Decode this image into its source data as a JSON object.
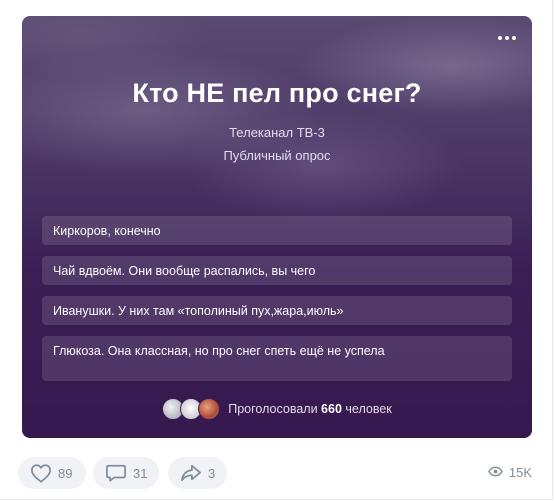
{
  "poll": {
    "title": "Кто НЕ пел про снег?",
    "author": "Телеканал ТВ-3",
    "type": "Публичный опрос",
    "answers": [
      {
        "label": "Киркоров, конечно"
      },
      {
        "label": "Чай вдвоём. Они вообще распались, вы чего"
      },
      {
        "label": "Иванушки. У них там «тополиный пух,жара,июль»"
      },
      {
        "label": "Глюкоза. Она классная, но про снег спеть ещё не успела"
      }
    ],
    "voters": {
      "prefix": "Проголосовали",
      "count": "660",
      "suffix": "человек"
    }
  },
  "actions": {
    "likes": "89",
    "comments": "31",
    "shares": "3",
    "views": "15K"
  },
  "colors": {
    "card_top": "#5a4a72",
    "card_bottom": "#35184e",
    "action_bg": "#f0f2f5",
    "action_text": "#818c99"
  },
  "icons": [
    "more-icon",
    "heart-icon",
    "comment-icon",
    "share-icon",
    "eye-icon"
  ]
}
